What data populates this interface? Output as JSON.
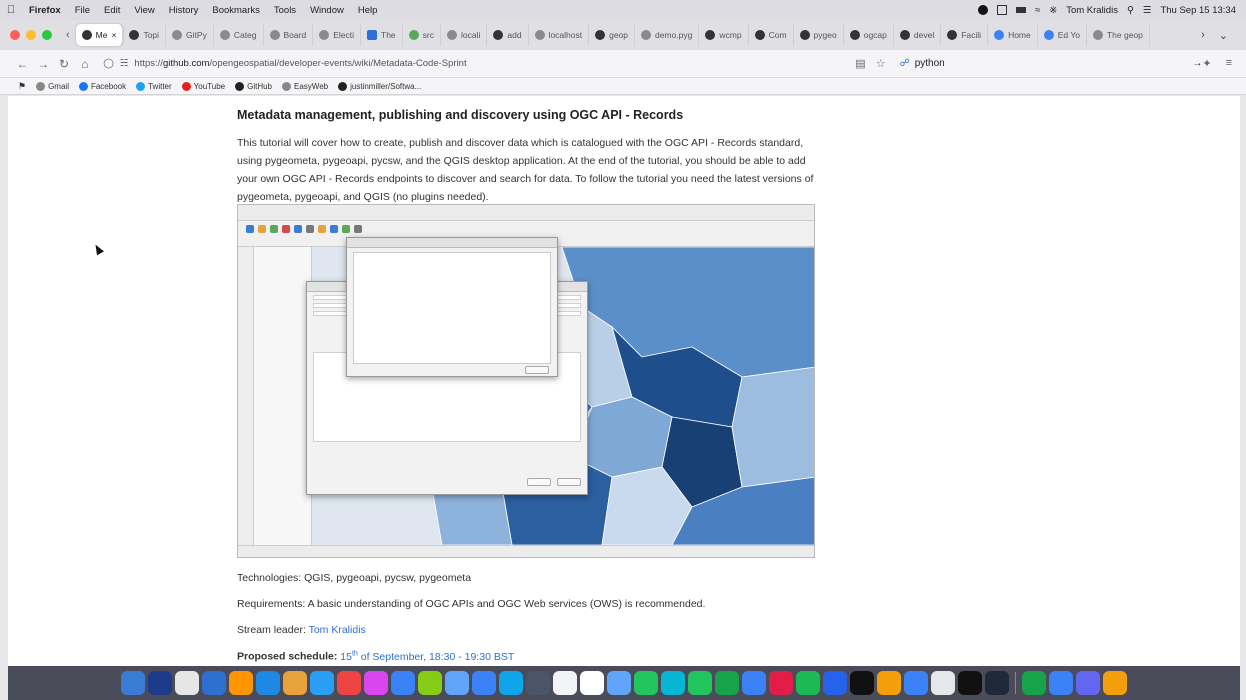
{
  "menubar": {
    "app": "Firefox",
    "items": [
      "File",
      "Edit",
      "View",
      "History",
      "Bookmarks",
      "Tools",
      "Window",
      "Help"
    ],
    "user": "Tom Kralidis",
    "clock": "Thu Sep 15  13:34"
  },
  "tabs": [
    {
      "label": "Me",
      "active": true,
      "fav": "github"
    },
    {
      "label": "Topi",
      "fav": "github"
    },
    {
      "label": "GitPy",
      "fav": "gray"
    },
    {
      "label": "Categ",
      "fav": "gray"
    },
    {
      "label": "Board",
      "fav": "gray"
    },
    {
      "label": "Electi",
      "fav": "gray"
    },
    {
      "label": "The",
      "fav": "blue"
    },
    {
      "label": "src",
      "fav": "green"
    },
    {
      "label": "locali",
      "fav": "gray"
    },
    {
      "label": "add",
      "fav": "github"
    },
    {
      "label": "localhost",
      "fav": "gray"
    },
    {
      "label": "geop",
      "fav": "github"
    },
    {
      "label": "demo.pyg",
      "fav": "gray"
    },
    {
      "label": "wcmp",
      "fav": "github"
    },
    {
      "label": "Com",
      "fav": "github"
    },
    {
      "label": "pygeo",
      "fav": "github"
    },
    {
      "label": "ogcap",
      "fav": "github"
    },
    {
      "label": "devel",
      "fav": "github"
    },
    {
      "label": "Facili",
      "fav": "github"
    },
    {
      "label": "Home",
      "fav": "tw"
    },
    {
      "label": "Ed Yo",
      "fav": "tw"
    },
    {
      "label": "The geop",
      "fav": "gray"
    }
  ],
  "navbar": {
    "url_prefix": "https://",
    "url_host": "github.com",
    "url_path": "/opengeospatial/developer-events/wiki/Metadata-Code-Sprint",
    "search_value": "python"
  },
  "bookmarks": [
    {
      "label": "Gmail",
      "color": "#888"
    },
    {
      "label": "Facebook",
      "color": "#1877f2"
    },
    {
      "label": "Twitter",
      "color": "#1da1f2"
    },
    {
      "label": "YouTube",
      "color": "#e62117"
    },
    {
      "label": "GitHub",
      "color": "#222"
    },
    {
      "label": "EasyWeb",
      "color": "#888"
    },
    {
      "label": "justinmiller/Softwa...",
      "color": "#222"
    }
  ],
  "article": {
    "title": "Metadata management, publishing and discovery using OGC API - Records",
    "intro": "This tutorial will cover how to create, publish and discover data which is catalogued with the OGC API - Records standard, using pygeometa, pygeoapi, pycsw, and the QGIS desktop application. At the end of the tutorial, you should be able to add your own OGC API - Records endpoints to discover and search for data. To follow the tutorial you need the latest versions of pygeometa, pygeoapi, and QGIS (no plugins needed).",
    "technologies": "Technologies: QGIS, pygeoapi, pycsw, pygeometa",
    "requirements": "Requirements: A basic understanding of OGC APIs and OGC Web services (OWS) is recommended.",
    "stream_label": "Stream leader: ",
    "stream_leader": "Tom Kralidis",
    "schedule_label": "Proposed schedule: ",
    "schedule_day": "15",
    "schedule_sup": "th",
    "schedule_rest": " of September, 18:30 - 19:30 BST"
  },
  "colors": {
    "link": "#2f6fcf",
    "map_dark": "#1f4e8c",
    "map_mid": "#5b8fc9",
    "map_light": "#b9cfe8"
  }
}
